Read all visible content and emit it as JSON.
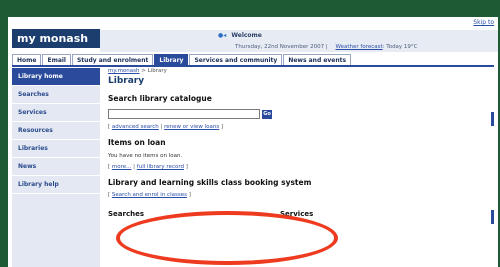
{
  "header": {
    "skip_link": "Skip to",
    "logo_text": "my monash",
    "welcome": "Welcome",
    "date_text": "Thursday, 22nd November 2007",
    "weather_link": "Weather forecast",
    "weather_text": ": Today 19°C"
  },
  "tabs": [
    {
      "label": "Home"
    },
    {
      "label": "Email"
    },
    {
      "label": "Study and enrolment"
    },
    {
      "label": "Library"
    },
    {
      "label": "Services and community"
    },
    {
      "label": "News and events"
    }
  ],
  "sidebar": {
    "items": [
      {
        "label": "Library home"
      },
      {
        "label": "Searches"
      },
      {
        "label": "Services"
      },
      {
        "label": "Resources"
      },
      {
        "label": "Libraries"
      },
      {
        "label": "News"
      },
      {
        "label": "Library help"
      }
    ]
  },
  "main": {
    "breadcrumb_link": "my.monash",
    "breadcrumb_sep": ">",
    "breadcrumb_current": "Library",
    "title": "Library",
    "catalogue_heading": "Search library catalogue",
    "go_label": "Go",
    "catalogue_link1": "advanced search",
    "catalogue_link2": "renew or view loans",
    "loans_heading": "Items on loan",
    "loans_note": "You have no items on loan.",
    "loans_link1": "more...",
    "loans_link2": "full library record",
    "booking_heading": "Library and learning skills class booking system",
    "booking_link": "Search and enrol in classes",
    "col1_heading": "Searches",
    "col2_heading": "Services"
  },
  "colors": {
    "frame_bg": "#1e5a34",
    "nav_blue": "#2a4a9c",
    "highlight_red": "#ee3b20"
  }
}
